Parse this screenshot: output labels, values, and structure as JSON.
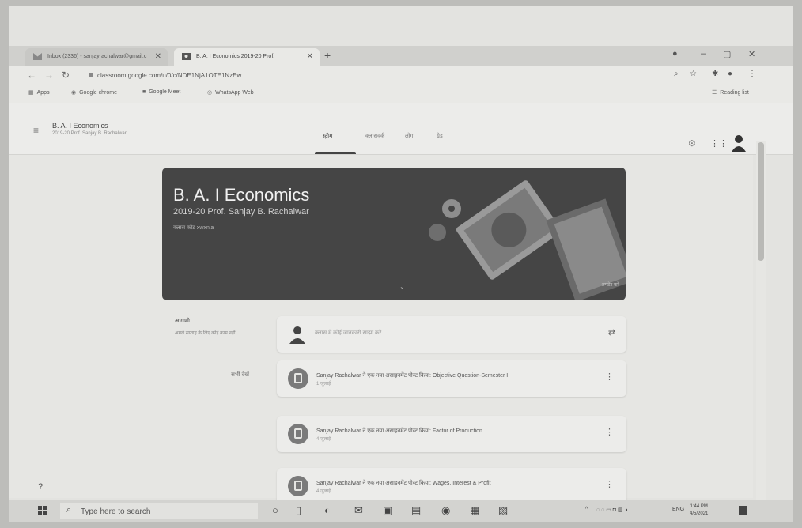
{
  "browser": {
    "tabs": [
      {
        "label": "Inbox (2336) - sanjayrachalwar@gmail.c",
        "active": false
      },
      {
        "label": "B. A. I Economics 2019-20 Prof.",
        "active": true
      }
    ],
    "new_tab": "+",
    "url": "classroom.google.com/u/0/c/NDE1NjA1OTE1NzEw",
    "bookmarks": [
      {
        "icon": "apps-icon",
        "label": "Apps"
      },
      {
        "icon": "google-chrome-icon",
        "label": "Google chrome"
      },
      {
        "icon": "google-meet-icon",
        "label": "Google Meet"
      },
      {
        "icon": "whatsapp-icon",
        "label": "WhatsApp Web"
      }
    ],
    "reading_list": "Reading list"
  },
  "classroom": {
    "class_name": "B. A. I Economics",
    "class_subtitle": "2019-20 Prof. Sanjay B. Rachalwar",
    "nav_tabs": [
      {
        "label": "स्ट्रीम",
        "selected": true
      },
      {
        "label": "क्लासवर्क",
        "selected": false
      },
      {
        "label": "लोग",
        "selected": false
      },
      {
        "label": "ग्रेड",
        "selected": false
      }
    ],
    "banner": {
      "title": "B. A. I Economics",
      "subtitle": "2019-20 Prof. Sanjay B. Rachalwar",
      "class_code": "क्लास कोड  xwxnla",
      "corner_text": "अपडेट करें"
    },
    "upcoming": {
      "title": "आगामी",
      "text": "अगले सप्ताह के लिए कोई काम नहीं!",
      "link": "सभी देखें"
    },
    "announce_placeholder": "क्लास में कोई जानकारी साझा करें",
    "posts": [
      {
        "text": "Sanjay Rachalwar ने एक नया असाइनमेंट पोस्ट किया: Objective Question-Semester I",
        "date": "1 जुलाई"
      },
      {
        "text": "Sanjay Rachalwar ने एक नया असाइनमेंट पोस्ट किया: Factor of Production",
        "date": "4 जुलाई"
      },
      {
        "text": "Sanjay Rachalwar ने एक नया असाइनमेंट पोस्ट किया: Wages, Interest & Profit",
        "date": "4 जुलाई"
      }
    ]
  },
  "taskbar": {
    "search_placeholder": "Type here to search",
    "language": "ENG",
    "time": "1:44 PM",
    "date": "4/5/2021"
  },
  "colors": {
    "banner": "#454545",
    "page": "#e6e6e3",
    "taskbar": "#d3d3d0"
  }
}
